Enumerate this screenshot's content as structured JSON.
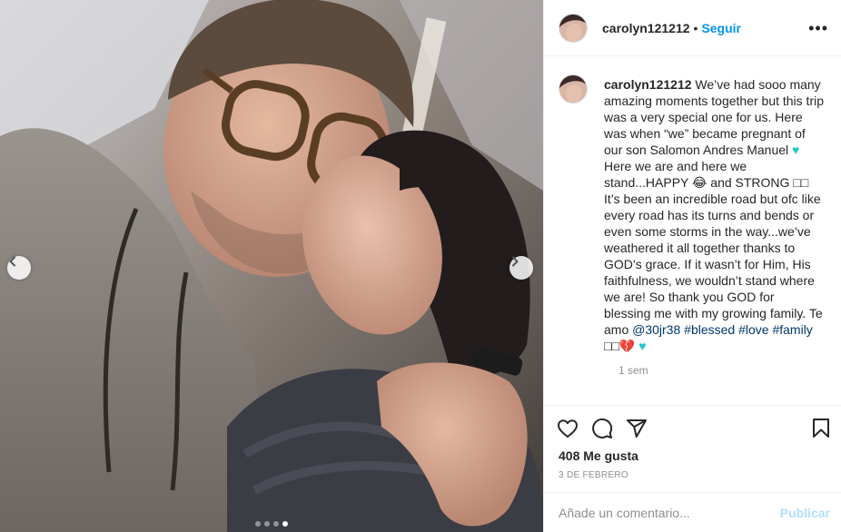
{
  "post": {
    "username": "carolyn121212",
    "separator": "•",
    "follow_label": "Seguir",
    "more_label": "•••",
    "caption": {
      "username": "carolyn121212",
      "text_1": "We’ve had sooo many amazing moments together but this trip was a very special one for us. Here was when “we” became pregnant of our son Salomon Andres Manuel",
      "heart_1": "♥",
      "text_2": "Here we are and here we stand...HAPPY",
      "emoji_1": "😂",
      "text_3": "and STRONG",
      "emoji_2": "□□",
      "text_4": "It’s been an incredible road but ofc like every road has its turns and bends or even some storms in the way...we’ve weathered it all together thanks to GOD’s grace. If it wasn’t for Him, His faithfulness, we wouldn’t stand where we are! So thank you GOD for blessing me with my growing family. Te amo",
      "mention": "@30jr38",
      "hashtags": [
        "#blessed",
        "#love",
        "#family"
      ],
      "emoji_3": "□□",
      "emoji_4": "💔",
      "heart_2": "♥"
    },
    "time_ago": "1 sem",
    "likes": "408 Me gusta",
    "date": "3 DE FEBRERO",
    "comment_placeholder": "Añade un comentario...",
    "publish_label": "Publicar",
    "carousel": {
      "slides": 4,
      "active_index": 3
    },
    "colors": {
      "accent": "#0095f6",
      "publish_disabled": "#b2dffc",
      "tag": "#00376b",
      "heart": "#1ec8c8"
    },
    "icons": [
      "chevron-left-icon",
      "chevron-right-icon",
      "heart-icon",
      "comment-icon",
      "share-icon",
      "bookmark-icon"
    ]
  }
}
